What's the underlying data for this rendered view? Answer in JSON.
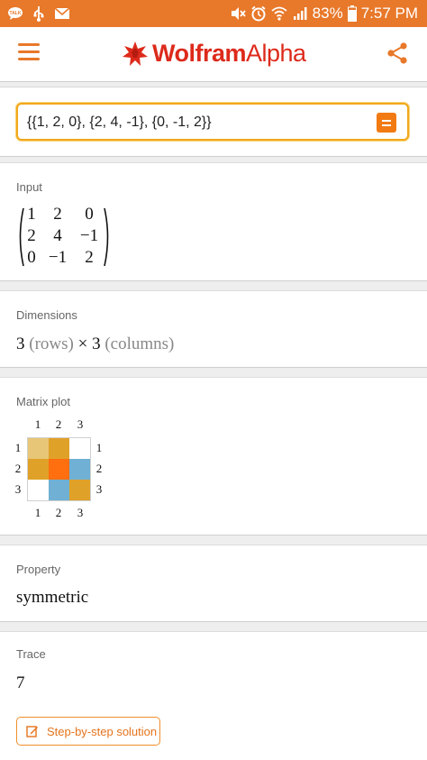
{
  "status_bar": {
    "battery": "83%",
    "time": "7:57 PM",
    "left_icons": [
      "talk-icon",
      "usb-icon",
      "mail-icon"
    ],
    "right_icons": [
      "mute-icon",
      "alarm-icon",
      "wifi-icon",
      "signal-icon",
      "battery-icon"
    ]
  },
  "header": {
    "logo_part1": "Wolfram",
    "logo_part2": "Alpha",
    "brand_color": "#dd2a1b",
    "accent_color": "#e8782a"
  },
  "search": {
    "value": "{{1, 2, 0}, {2, 4, -1}, {0, -1, 2}}"
  },
  "pods": {
    "input": {
      "title": "Input",
      "matrix": [
        [
          "1",
          "2",
          "0"
        ],
        [
          "2",
          "4",
          "−1"
        ],
        [
          "0",
          "−1",
          "2"
        ]
      ]
    },
    "dimensions": {
      "title": "Dimensions",
      "rows_value": "3",
      "rows_unit": "(rows)",
      "times": "×",
      "cols_value": "3",
      "cols_unit": "(columns)"
    },
    "matrix_plot": {
      "title": "Matrix plot",
      "labels": [
        "1",
        "2",
        "3"
      ],
      "cell_colors": [
        [
          "#e8c678",
          "#e0a128",
          "#ffffff"
        ],
        [
          "#e0a128",
          "#ff6e0f",
          "#6fb0d4"
        ],
        [
          "#ffffff",
          "#6fb0d4",
          "#e0a128"
        ]
      ]
    },
    "property": {
      "title": "Property",
      "value": "symmetric"
    },
    "trace": {
      "title": "Trace",
      "value": "7",
      "button_label": "Step-by-step solution"
    }
  }
}
